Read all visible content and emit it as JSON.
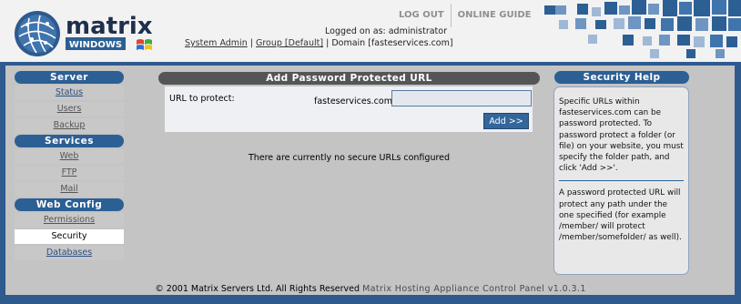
{
  "brand": {
    "name": "matrix",
    "edition": "WINDOWS"
  },
  "topnav": {
    "logout": "LOG OUT",
    "guide": "ONLINE GUIDE"
  },
  "session": {
    "logged_as": "Logged on as: administrator",
    "crumbs": {
      "system_admin": "System Admin",
      "sep1": " | ",
      "group": "Group [Default]",
      "sep2": " | ",
      "domain": "Domain [fasteservices.com]"
    }
  },
  "sidebar": {
    "sections": [
      {
        "title": "Server",
        "items": [
          "Status",
          "Users",
          "Backup"
        ]
      },
      {
        "title": "Services",
        "items": [
          "Web",
          "FTP",
          "Mail"
        ]
      },
      {
        "title": "Web Config",
        "items": [
          "Permissions",
          "Security",
          "Databases"
        ]
      }
    ],
    "active_item": "Security"
  },
  "main": {
    "title": "Add Password Protected URL",
    "url_label": "URL to protect:",
    "url_prefix": "fasteservices.com/",
    "url_value": "",
    "add_button": "Add >>",
    "empty_message": "There are currently no secure URLs configured"
  },
  "help": {
    "title": "Security Help",
    "p1": "Specific URLs within fasteservices.com can be password protected. To password protect a folder (or file) on your website, you must specify the folder path, and click 'Add >>'.",
    "p2": "A password protected URL will protect any path under the one specified (for example /member/ will protect /member/somefolder/ as well)."
  },
  "footer": {
    "copyright": "© 2001 Matrix Servers Ltd. All Rights Reserved",
    "product": "Matrix Hosting Appliance Control Panel v1.0.3.1"
  },
  "colors": {
    "page_bg": "#2e5a8e",
    "section_blue": "#2c5f94",
    "panel_head_grey": "#555555",
    "frame_grey": "#c4c4c4"
  },
  "icons": [
    "globe-logo-icon",
    "windows-flag-icon"
  ]
}
